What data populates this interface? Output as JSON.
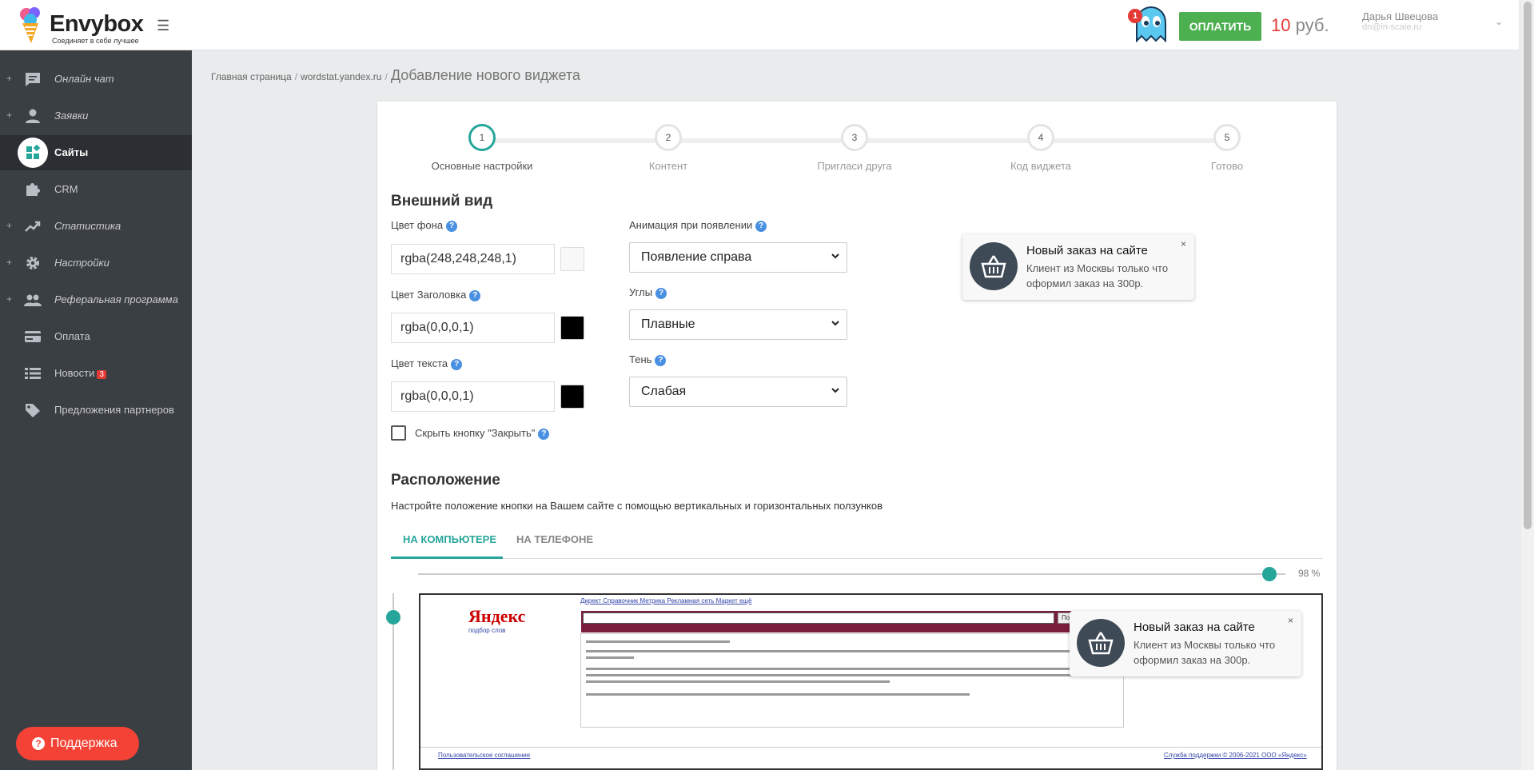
{
  "header": {
    "logo_text": "Envybox",
    "logo_sub": "Соединяет в себе лучшее",
    "notification_count": "1",
    "pay_label": "ОПЛАТИТЬ",
    "balance_amount": "10",
    "balance_currency": "руб.",
    "user_name": "Дарья Швецова",
    "user_email": "dn@in-scale.ru"
  },
  "sidebar": {
    "items": [
      {
        "label": "Онлайн чат",
        "icon": "chat-icon"
      },
      {
        "label": "Заявки",
        "icon": "person-icon"
      },
      {
        "label": "Сайты",
        "icon": "widgets-icon"
      },
      {
        "label": "CRM",
        "icon": "puzzle-icon"
      },
      {
        "label": "Статистика",
        "icon": "trend-icon"
      },
      {
        "label": "Настройки",
        "icon": "gear-icon"
      },
      {
        "label": "Реферальная программа",
        "icon": "people-icon"
      },
      {
        "label": "Оплата",
        "icon": "card-icon"
      },
      {
        "label": "Новости",
        "icon": "list-icon",
        "badge": "3"
      },
      {
        "label": "Предложения партнеров",
        "icon": "tag-icon"
      }
    ],
    "support_label": "Поддержка"
  },
  "breadcrumb": {
    "home": "Главная страница",
    "site": "wordstat.yandex.ru",
    "current": "Добавление нового виджета"
  },
  "steps": [
    {
      "num": "1",
      "label": "Основные настройки"
    },
    {
      "num": "2",
      "label": "Контент"
    },
    {
      "num": "3",
      "label": "Пригласи друга"
    },
    {
      "num": "4",
      "label": "Код виджета"
    },
    {
      "num": "5",
      "label": "Готово"
    }
  ],
  "appearance": {
    "title": "Внешний вид",
    "bg_color_label": "Цвет фона",
    "bg_color_value": "rgba(248,248,248,1)",
    "bg_color_swatch": "#f8f8f8",
    "heading_color_label": "Цвет Заголовка",
    "heading_color_value": "rgba(0,0,0,1)",
    "heading_color_swatch": "#000000",
    "text_color_label": "Цвет текста",
    "text_color_value": "rgba(0,0,0,1)",
    "text_color_swatch": "#000000",
    "hide_close_label": "Скрыть кнопку \"Закрыть\"",
    "animation_label": "Анимация при появлении",
    "animation_value": "Появление справа",
    "corners_label": "Углы",
    "corners_value": "Плавные",
    "shadow_label": "Тень",
    "shadow_value": "Слабая"
  },
  "toast": {
    "title": "Новый заказ на сайте",
    "text": "Клиент из Москвы только что оформил заказ на 300р.",
    "close": "×"
  },
  "position": {
    "title": "Расположение",
    "description": "Настройте положение кнопки на Вашем сайте с помощью вертикальных и горизонтальных ползунков",
    "tab_desktop": "НА КОМПЬЮТЕРЕ",
    "tab_phone": "НА ТЕЛЕФОНЕ",
    "h_value": "98 %"
  },
  "preview": {
    "top_links": "Директ   Справочник   Метрика   Рекламная сеть   Маркет   ещё",
    "logo": "Яндекс",
    "logo_sub": "подбор слов",
    "search_button": "Подобрать",
    "footer_left": "Пользовательское соглашение",
    "footer_right": "Служба поддержки        © 2006-2021  ООО «Яндекс»"
  },
  "colors": {
    "accent": "#26a69a",
    "pay_green": "#4caf50",
    "danger": "#e53935",
    "sidebar_bg": "#3a3f44"
  }
}
